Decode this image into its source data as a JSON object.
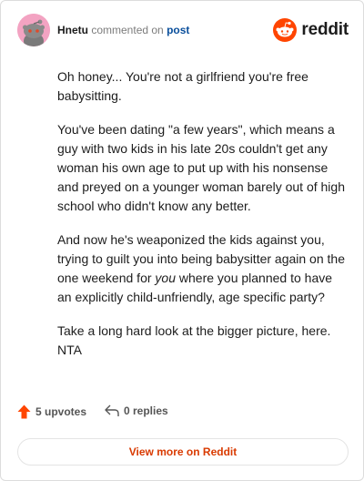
{
  "header": {
    "username": "Hnetu",
    "commented_on": "commented on",
    "post_link": "post",
    "brand": "reddit",
    "brand_color": "#ff4500"
  },
  "comment": {
    "paragraphs": [
      "Oh honey... You're not a girlfriend you're free babysitting.",
      "You've been dating \"a few years\", which means a guy with two kids in his late 20s couldn't get any woman his own age to put up with his nonsense and preyed on a younger woman barely out of high school who didn't know any better.",
      "And now he's weaponized the kids against you, trying to guilt you into being babysitter again on the one weekend for",
      "you",
      "where you planned to have an explicitly child-unfriendly, age specific party?",
      "Take a long hard look at the bigger picture, here. NTA"
    ]
  },
  "footer": {
    "upvotes": "5 upvotes",
    "replies": "0 replies",
    "upvote_icon_color": "#ff4500"
  },
  "cta": {
    "label": "View more on Reddit"
  }
}
